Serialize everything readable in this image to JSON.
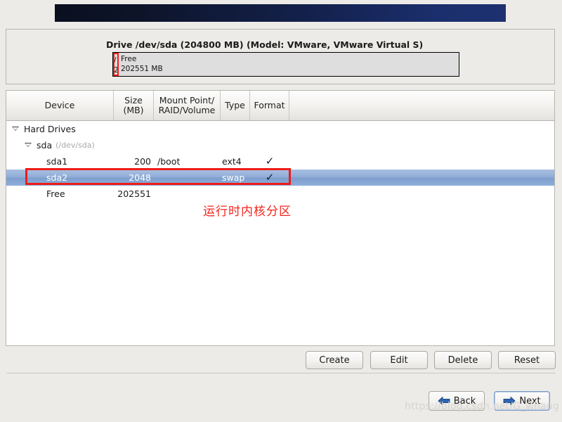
{
  "banner": {
    "name": "installer-header-banner"
  },
  "drive": {
    "title": "Drive /dev/sda (204800 MB) (Model: VMware, VMware Virtual S)",
    "segments": [
      {
        "name": "partition-segment-small",
        "line1": "/",
        "line2": "2",
        "highlighted": true
      },
      {
        "name": "free-space-segment",
        "line1": "Free",
        "line2": "202551 MB",
        "highlighted": false
      }
    ]
  },
  "table": {
    "headers": [
      "Device",
      "Size\n(MB)",
      "Mount Point/\nRAID/Volume",
      "Type",
      "Format"
    ],
    "header_device": "Device",
    "header_size_l1": "Size",
    "header_size_l2": "(MB)",
    "header_mount_l1": "Mount Point/",
    "header_mount_l2": "RAID/Volume",
    "header_type": "Type",
    "header_format": "Format",
    "rows": [
      {
        "name": "tree-group-hard-drives",
        "device": "Hard Drives",
        "path": "",
        "size": "",
        "mount": "",
        "type": "",
        "format": "",
        "level": 1,
        "expander": true,
        "selected": false
      },
      {
        "name": "tree-node-sda",
        "device": "sda",
        "path": "(/dev/sda)",
        "size": "",
        "mount": "",
        "type": "",
        "format": "",
        "level": 2,
        "expander": true,
        "selected": false
      },
      {
        "name": "partition-row-sda1",
        "device": "sda1",
        "path": "",
        "size": "200",
        "mount": "/boot",
        "type": "ext4",
        "format": "✓",
        "level": 3,
        "expander": false,
        "selected": false
      },
      {
        "name": "partition-row-sda2",
        "device": "sda2",
        "path": "",
        "size": "2048",
        "mount": "",
        "type": "swap",
        "format": "✓",
        "level": 3,
        "expander": false,
        "selected": true
      },
      {
        "name": "partition-row-free",
        "device": "Free",
        "path": "",
        "size": "202551",
        "mount": "",
        "type": "",
        "format": "",
        "level": 3,
        "expander": false,
        "selected": false
      }
    ]
  },
  "annotation": {
    "text": "运行时内核分区",
    "color": "#f5231b",
    "highlight_color": "#ee1c18"
  },
  "actions": {
    "create": "Create",
    "edit": "Edit",
    "delete": "Delete",
    "reset": "Reset"
  },
  "navigation": {
    "back": "Back",
    "next": "Next",
    "arrow_color": "#2b5fa8"
  },
  "watermark": "https://blog.csdn.net/G_whang"
}
